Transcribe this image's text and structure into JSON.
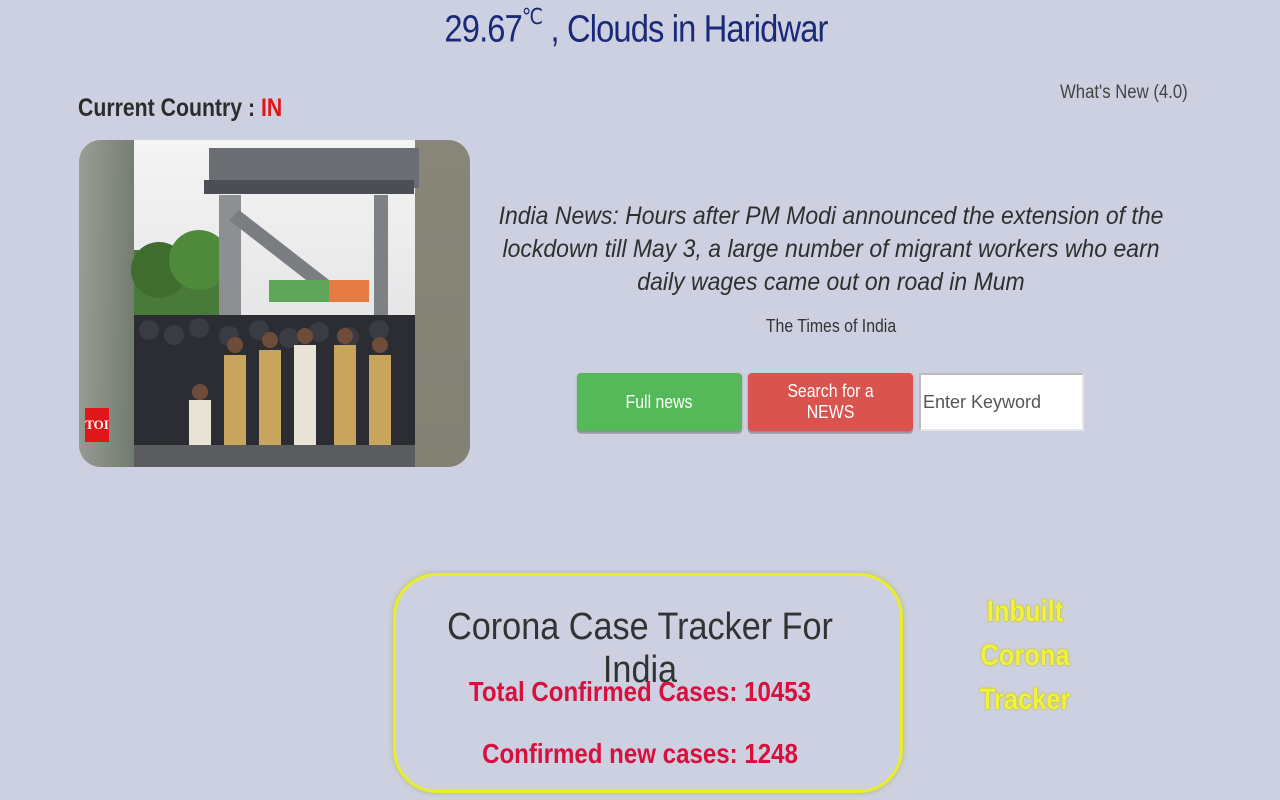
{
  "weather": {
    "temperature": "29.67",
    "unit": "℃",
    "condition": " , Clouds in Haridwar"
  },
  "whats_new": "What's New (4.0)",
  "country": {
    "label": "Current Country : ",
    "code": "IN"
  },
  "news": {
    "badge": "TOI",
    "headline": "India News: Hours after PM Modi announced the extension of the lockdown till May 3, a large number of migrant workers who earn daily wages came out on road in Mum",
    "source": "The Times of India"
  },
  "buttons": {
    "full_news": "Full news",
    "search_news": "Search for a NEWS"
  },
  "search": {
    "placeholder": "Enter Keyword",
    "value": ""
  },
  "tracker": {
    "title": "Corona Case Tracker For India",
    "total_confirmed": "Total Confirmed Cases: 10453",
    "new_cases": "Confirmed new cases: 1248"
  },
  "inbuilt_label": "Inbuilt Corona Tracker",
  "colors": {
    "background": "#cdd0e0",
    "weather_text": "#1b2a78",
    "country_code": "#e1161b",
    "button_green": "#55b95a",
    "button_red": "#d9534f",
    "tracker_border": "#e8ee2a",
    "case_text": "#d8103e"
  }
}
